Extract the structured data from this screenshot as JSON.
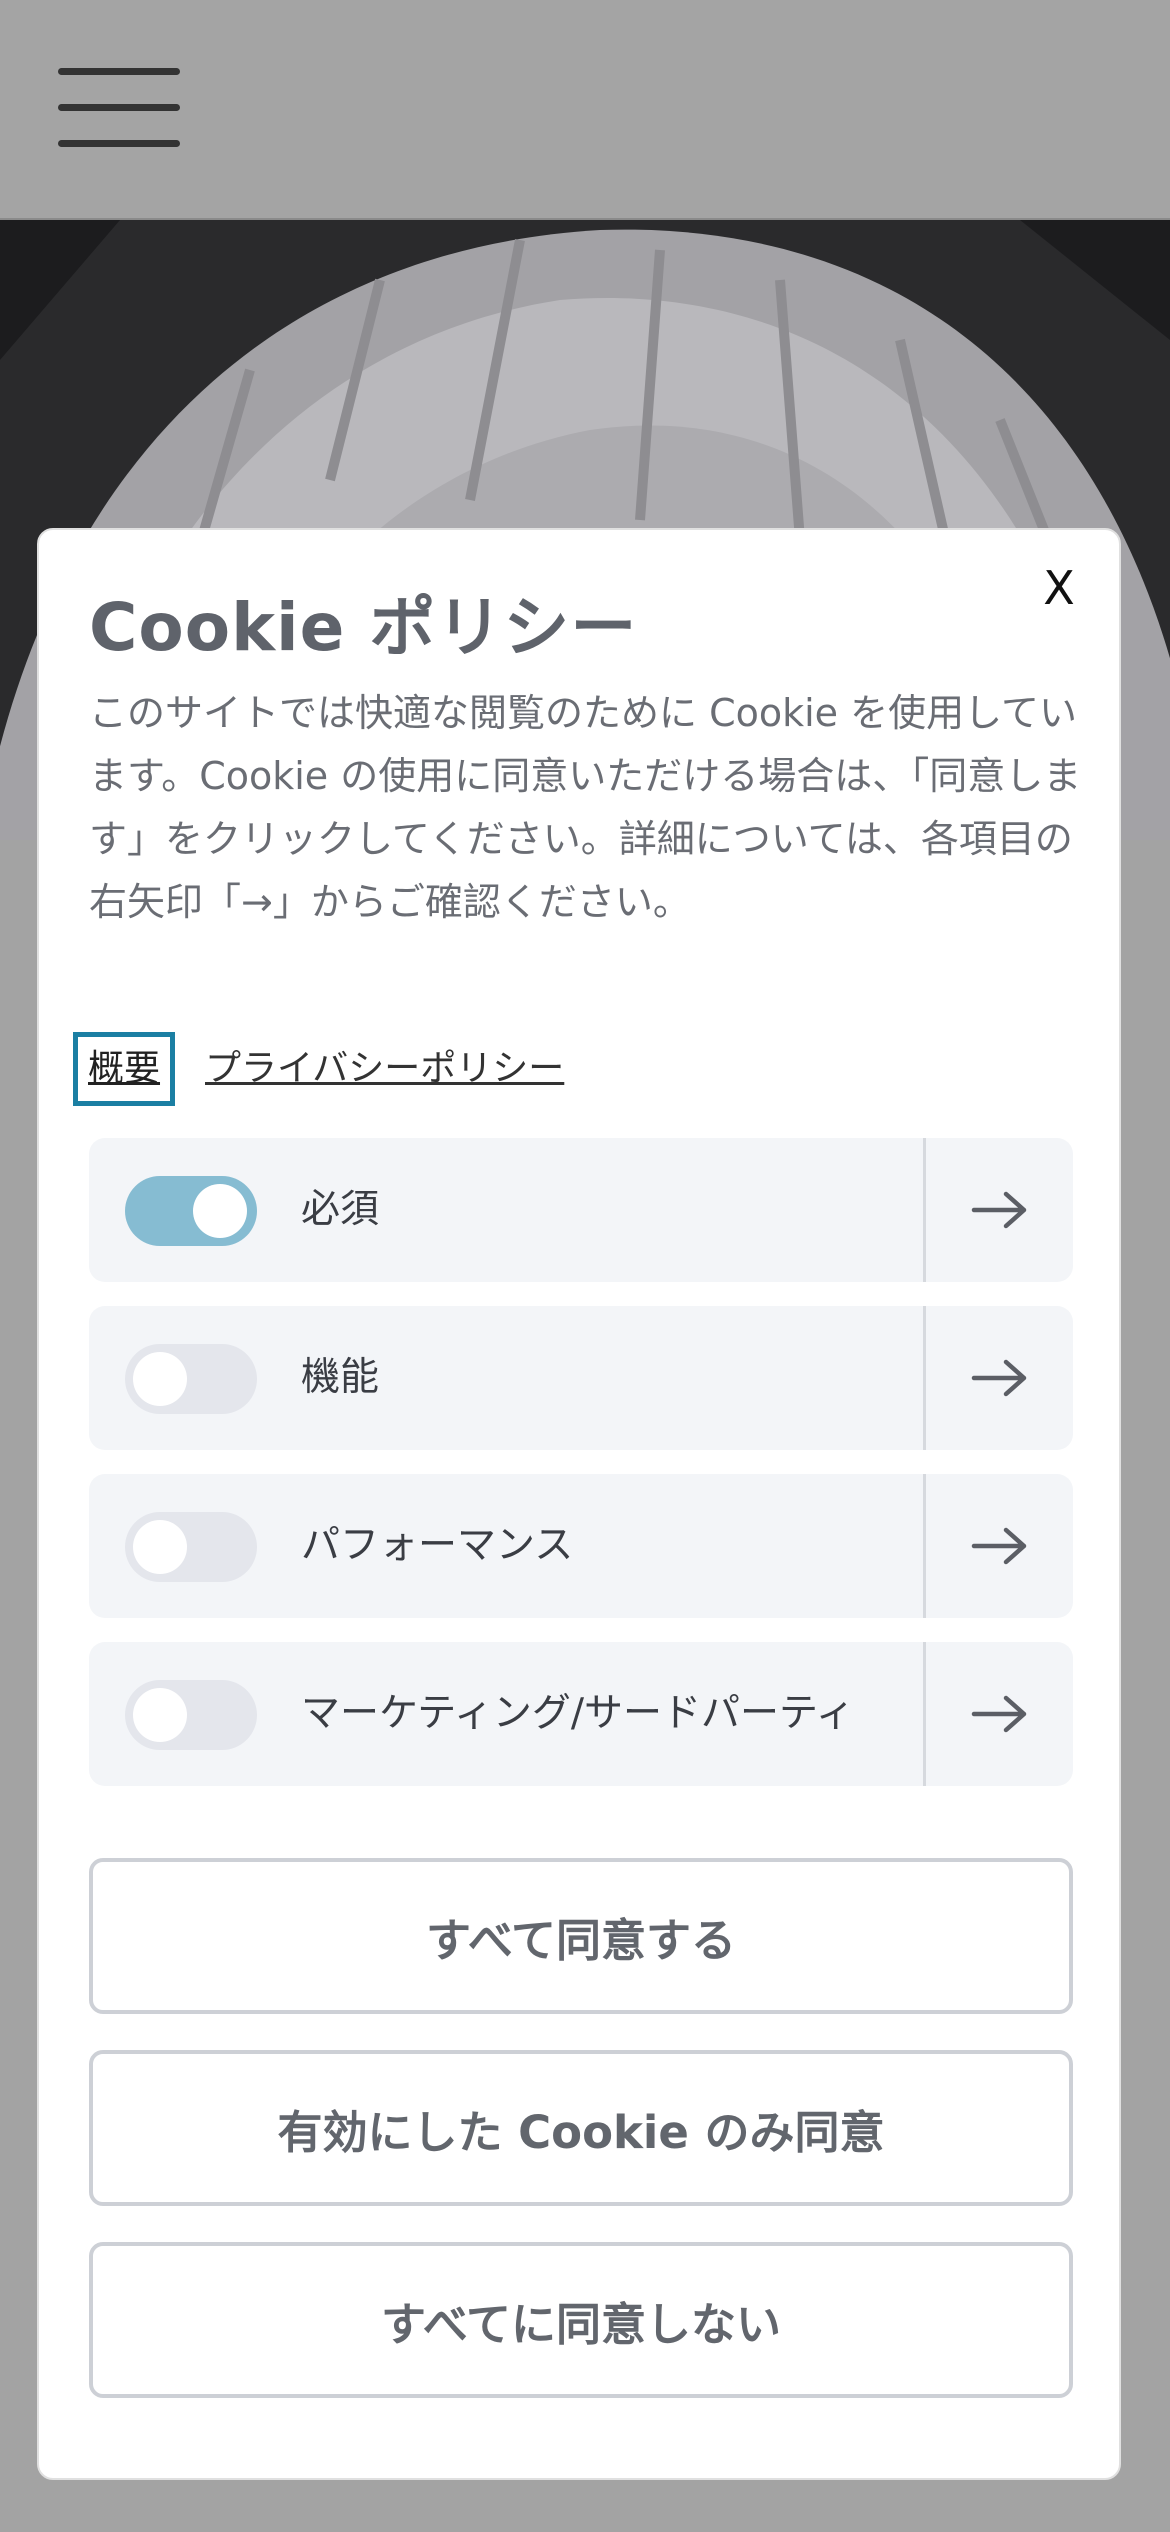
{
  "header": {
    "menu_icon": "hamburger-menu-icon"
  },
  "modal": {
    "title": "Cookie ポリシー",
    "close_label": "X",
    "description": "このサイトでは快適な閲覧のために Cookie を使用しています。Cookie の使用に同意いただける場合は、「同意します」をクリックしてください。詳細については、各項目の右矢印「→」からご確認ください。",
    "links": {
      "summary": "概要",
      "privacy": "プライバシーポリシー"
    },
    "categories": [
      {
        "label": "必須",
        "enabled": true,
        "arrow_icon": "arrow-right-icon"
      },
      {
        "label": "機能",
        "enabled": false,
        "arrow_icon": "arrow-right-icon"
      },
      {
        "label": "パフォーマンス",
        "enabled": false,
        "arrow_icon": "arrow-right-icon"
      },
      {
        "label": "マーケティング/サードパーティ",
        "enabled": false,
        "arrow_icon": "arrow-right-icon"
      }
    ],
    "buttons": {
      "accept_all": "すべて同意する",
      "accept_selected": "有効にした Cookie のみ同意",
      "reject_all": "すべてに同意しない"
    }
  },
  "colors": {
    "toggle_on": "#86bcd2",
    "toggle_off": "#e4e6ec",
    "focus_outline": "#1b7fa3",
    "title_text": "#5f636b"
  }
}
